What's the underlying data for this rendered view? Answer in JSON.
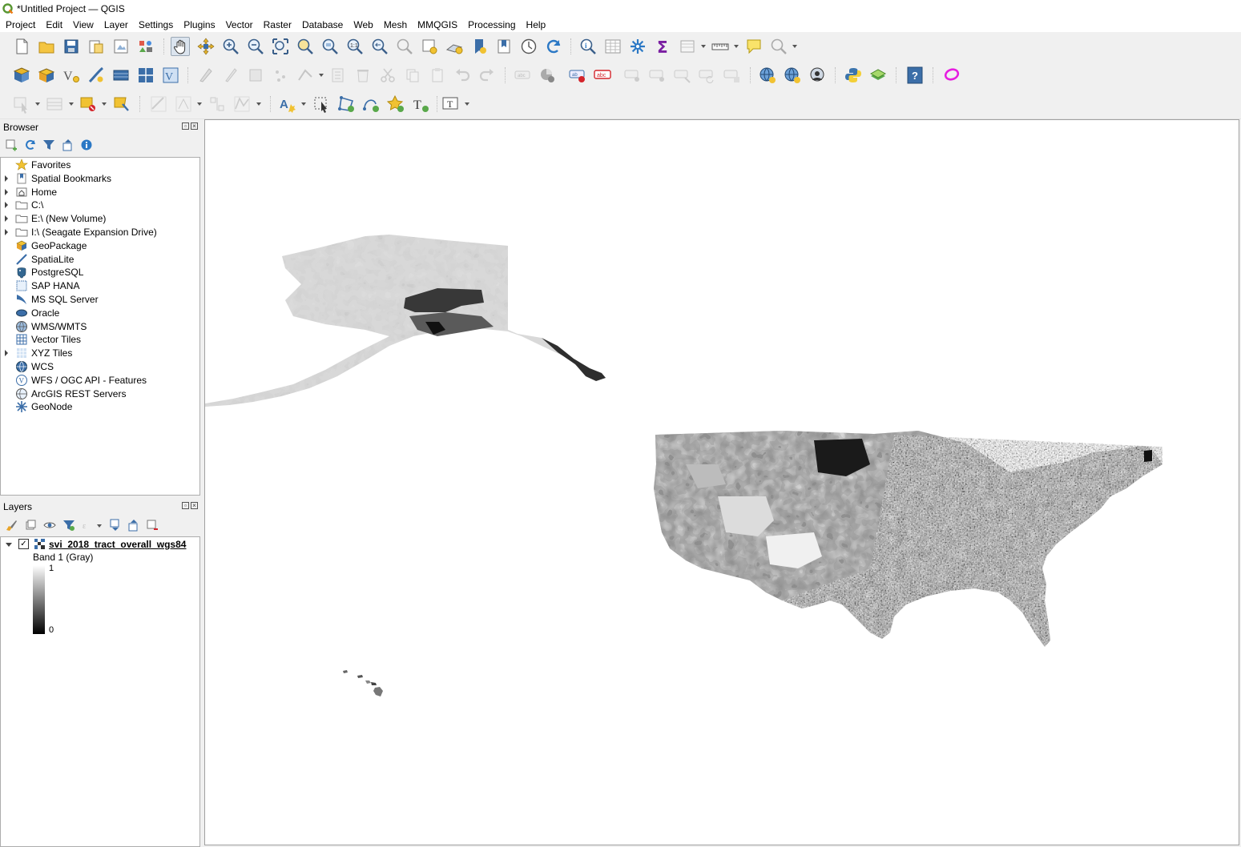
{
  "window": {
    "title": "*Untitled Project — QGIS"
  },
  "menu": [
    "Project",
    "Edit",
    "View",
    "Layer",
    "Settings",
    "Plugins",
    "Vector",
    "Raster",
    "Database",
    "Web",
    "Mesh",
    "MMQGIS",
    "Processing",
    "Help"
  ],
  "browser": {
    "title": "Browser",
    "items": [
      {
        "label": "Favorites",
        "icon": "star-icon",
        "expandable": false
      },
      {
        "label": "Spatial Bookmarks",
        "icon": "bookmark-icon",
        "expandable": true
      },
      {
        "label": "Home",
        "icon": "home-folder-icon",
        "expandable": true
      },
      {
        "label": "C:\\",
        "icon": "folder-icon",
        "expandable": true
      },
      {
        "label": "E:\\ (New Volume)",
        "icon": "folder-icon",
        "expandable": true
      },
      {
        "label": "I:\\ (Seagate Expansion Drive)",
        "icon": "folder-icon",
        "expandable": true
      },
      {
        "label": "GeoPackage",
        "icon": "geopackage-icon",
        "expandable": false
      },
      {
        "label": "SpatiaLite",
        "icon": "spatialite-icon",
        "expandable": false
      },
      {
        "label": "PostgreSQL",
        "icon": "postgresql-icon",
        "expandable": false
      },
      {
        "label": "SAP HANA",
        "icon": "sap-hana-icon",
        "expandable": false
      },
      {
        "label": "MS SQL Server",
        "icon": "mssql-icon",
        "expandable": false
      },
      {
        "label": "Oracle",
        "icon": "oracle-icon",
        "expandable": false
      },
      {
        "label": "WMS/WMTS",
        "icon": "wms-globe-icon",
        "expandable": false
      },
      {
        "label": "Vector Tiles",
        "icon": "vector-tiles-icon",
        "expandable": false
      },
      {
        "label": "XYZ Tiles",
        "icon": "xyz-tiles-icon",
        "expandable": true
      },
      {
        "label": "WCS",
        "icon": "wcs-globe-icon",
        "expandable": false
      },
      {
        "label": "WFS / OGC API - Features",
        "icon": "wfs-icon",
        "expandable": false
      },
      {
        "label": "ArcGIS REST Servers",
        "icon": "arcgis-icon",
        "expandable": false
      },
      {
        "label": "GeoNode",
        "icon": "geonode-icon",
        "expandable": false
      }
    ]
  },
  "layers": {
    "title": "Layers",
    "layer_name": "svi_2018_tract_overall_wgs84",
    "layer_checked": true,
    "band_label": "Band 1 (Gray)",
    "legend_max": "1",
    "legend_min": "0"
  }
}
